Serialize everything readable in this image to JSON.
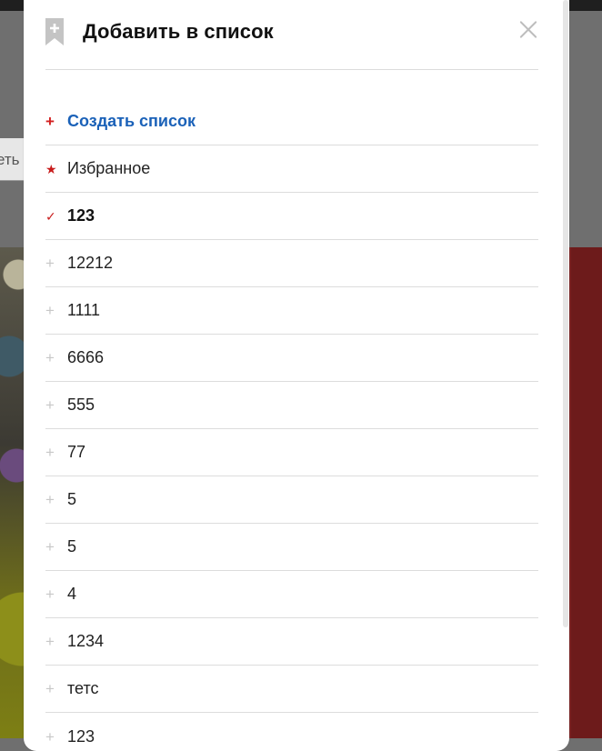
{
  "background": {
    "partial_text": "еть"
  },
  "modal": {
    "title": "Добавить в список",
    "create_label": "Создать список",
    "items": [
      {
        "label": "Избранное",
        "icon": "star-icon",
        "state": "favorite"
      },
      {
        "label": "123",
        "icon": "check-icon",
        "state": "selected"
      },
      {
        "label": "12212",
        "icon": "plus-icon",
        "state": "unselected"
      },
      {
        "label": "1111",
        "icon": "plus-icon",
        "state": "unselected"
      },
      {
        "label": "6666",
        "icon": "plus-icon",
        "state": "unselected"
      },
      {
        "label": "555",
        "icon": "plus-icon",
        "state": "unselected"
      },
      {
        "label": "77",
        "icon": "plus-icon",
        "state": "unselected"
      },
      {
        "label": "5",
        "icon": "plus-icon",
        "state": "unselected"
      },
      {
        "label": "5",
        "icon": "plus-icon",
        "state": "unselected"
      },
      {
        "label": "4",
        "icon": "plus-icon",
        "state": "unselected"
      },
      {
        "label": "1234",
        "icon": "plus-icon",
        "state": "unselected"
      },
      {
        "label": "тетс",
        "icon": "plus-icon",
        "state": "unselected"
      },
      {
        "label": "123",
        "icon": "plus-icon",
        "state": "unselected"
      }
    ]
  },
  "colors": {
    "accent_red": "#c81b1b",
    "link_blue": "#1a61b8",
    "divider": "#dcdcdc",
    "overlay": "#6f6f6f"
  }
}
